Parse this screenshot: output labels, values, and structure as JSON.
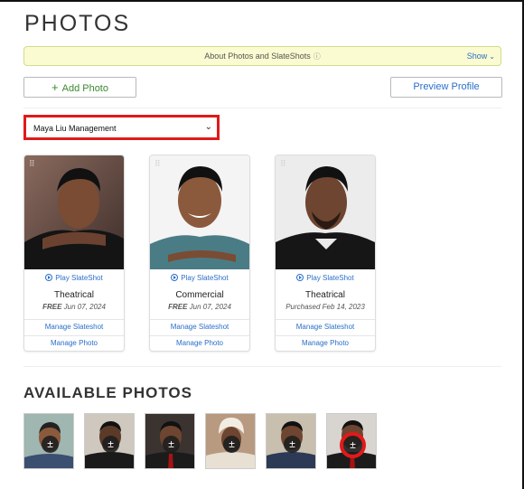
{
  "page": {
    "title": "PHOTOS"
  },
  "info_bar": {
    "text": "About Photos and SlateShots",
    "info_icon": "ⓘ",
    "show_label": "Show",
    "show_icon": "chevron-down-icon"
  },
  "buttons": {
    "add_photo": "Add Photo",
    "add_icon": "+",
    "preview_profile": "Preview Profile"
  },
  "agency_select": {
    "selected": "Maya Liu Management"
  },
  "photo_cards": [
    {
      "play_label": "Play SlateShot",
      "type": "Theatrical",
      "date_prefix": "FREE",
      "date_text": "Jun 07, 2024",
      "manage_slateshot": "Manage Slateshot",
      "manage_photo": "Manage Photo"
    },
    {
      "play_label": "Play SlateShot",
      "type": "Commercial",
      "date_prefix": "FREE",
      "date_text": "Jun 07, 2024",
      "manage_slateshot": "Manage Slateshot",
      "manage_photo": "Manage Photo"
    },
    {
      "play_label": "Play SlateShot",
      "type": "Theatrical",
      "date_prefix": "",
      "date_text": "Purchased Feb 14, 2023",
      "manage_slateshot": "Manage Slateshot",
      "manage_photo": "Manage Photo"
    }
  ],
  "available": {
    "title": "AVAILABLE PHOTOS",
    "toggle_icon": "±",
    "thumbnail_count": 6
  },
  "colors": {
    "link": "#2a6fc9",
    "add_green": "#3a8a2e",
    "highlight_red": "#e01a1a",
    "info_bg": "#fafbd0"
  }
}
